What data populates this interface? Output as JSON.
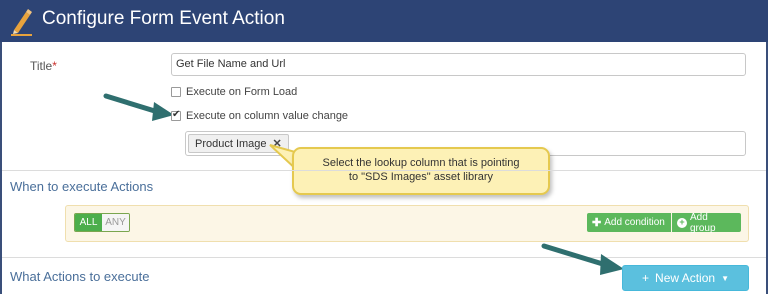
{
  "header": {
    "title": "Configure Form Event Action",
    "icon": "pencil-icon"
  },
  "form": {
    "title_label": "Title",
    "required_mark": "*",
    "title_value": "Get File Name and Url",
    "option_form_load": {
      "label": "Execute on Form Load",
      "checked": false
    },
    "option_column_change": {
      "label": "Execute on column value change",
      "checked": true
    },
    "selected_column": "Product Image",
    "remove_glyph": "✕"
  },
  "callout": {
    "line1": "Select the lookup column that is pointing",
    "line2": "to \"SDS Images\" asset library"
  },
  "when_section": {
    "title": "When to execute Actions",
    "toggle_all": "ALL",
    "toggle_any": "ANY",
    "add_condition": "Add condition",
    "add_group": "Add group"
  },
  "what_section": {
    "title": "What Actions to execute",
    "new_action": "New Action"
  },
  "colors": {
    "header_bg": "#2d4475",
    "accent_green": "#5cb85c",
    "accent_info": "#5bc0de",
    "callout_bg": "#fdf1b6",
    "arrow": "#2f6f6f"
  }
}
